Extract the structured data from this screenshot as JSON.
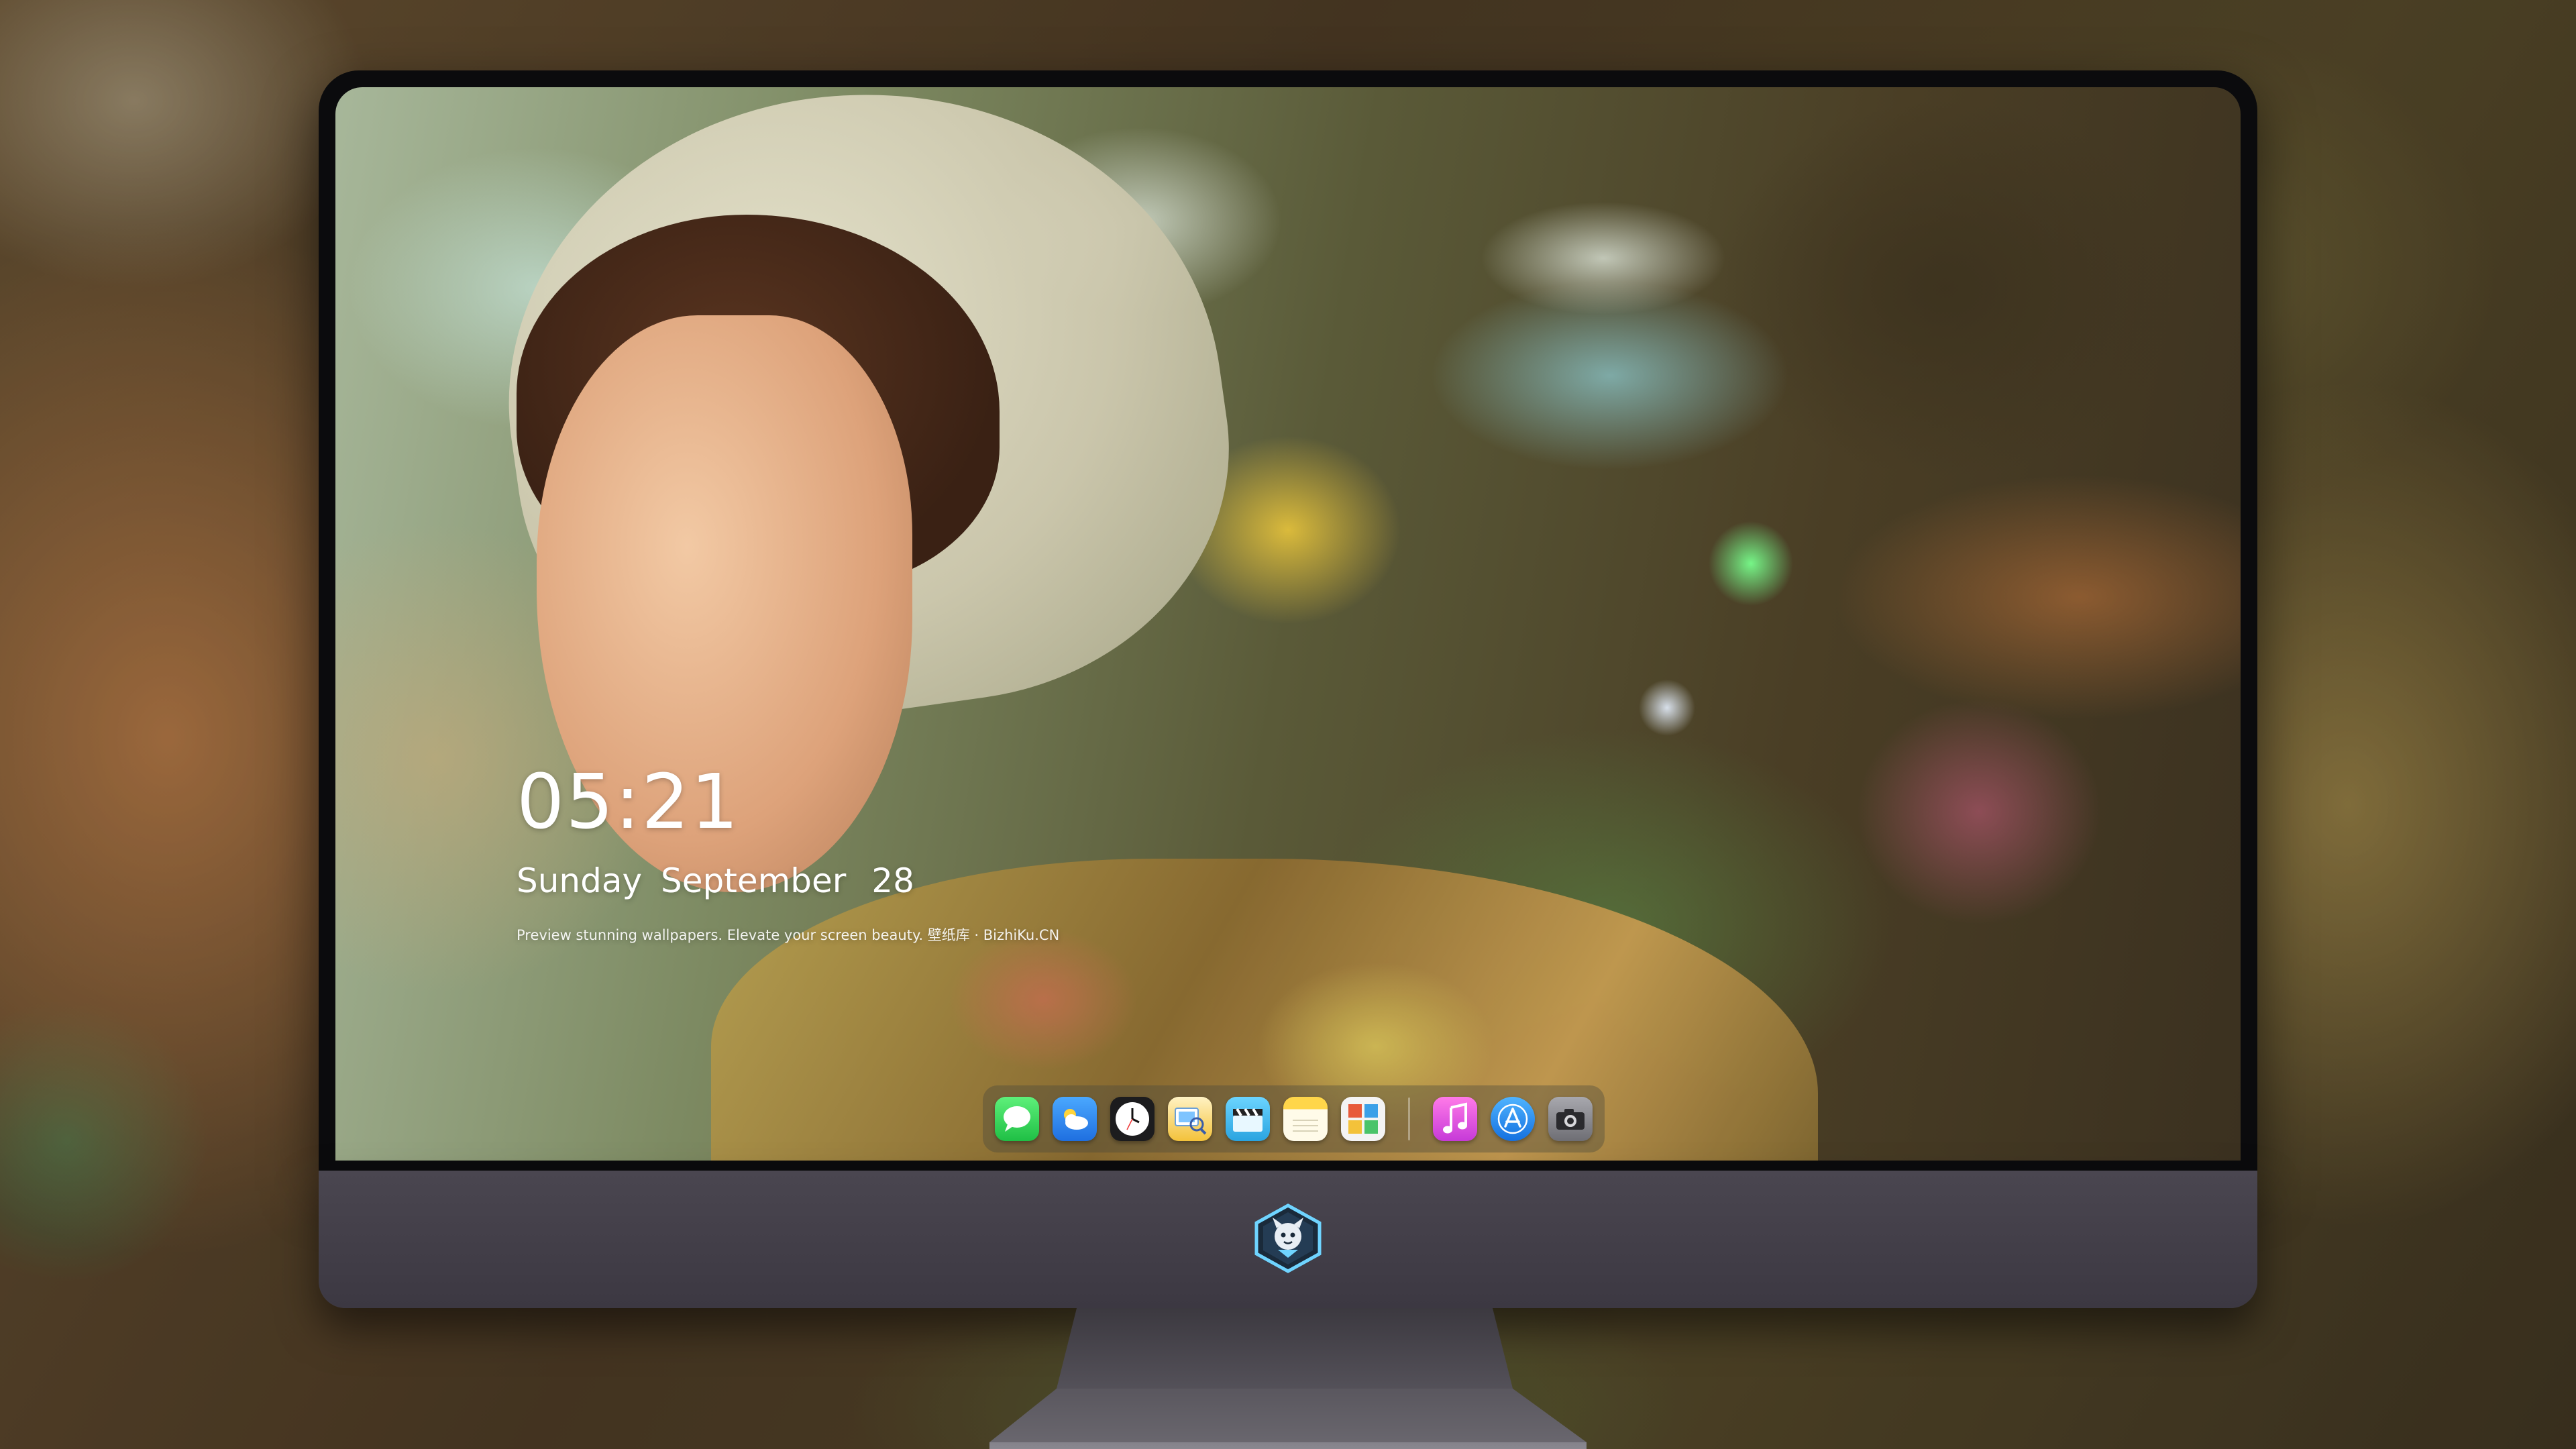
{
  "lockscreen": {
    "time": "05:21",
    "weekday": "Sunday",
    "month": "September",
    "day": "28",
    "caption": "Preview stunning wallpapers. Elevate your screen beauty. 壁纸库 · BizhiKu.CN"
  },
  "dock": {
    "apps": [
      {
        "name": "Messages",
        "icon": "message-bubble",
        "color": "#2fd05a"
      },
      {
        "name": "Weather",
        "icon": "cloud-sun",
        "color": "#2d8cf0"
      },
      {
        "name": "Clock",
        "icon": "clock-face",
        "color": "#ffffff"
      },
      {
        "name": "Preview",
        "icon": "photo-magnifier",
        "color": "#f3c23a"
      },
      {
        "name": "Clips",
        "icon": "clapperboard",
        "color": "#39b8e8"
      },
      {
        "name": "Notes",
        "icon": "notepad",
        "color": "#ffd24a"
      },
      {
        "name": "Photo Booth",
        "icon": "photo-grid",
        "color": "#e85a3a"
      },
      {
        "name": "Music",
        "icon": "music-note",
        "color": "#e84ad8"
      },
      {
        "name": "App Store",
        "icon": "app-store-a",
        "color": "#1e90ff"
      },
      {
        "name": "Camera",
        "icon": "camera",
        "color": "#8e8e93"
      }
    ]
  },
  "monitor": {
    "logo": "mascot-badge"
  }
}
